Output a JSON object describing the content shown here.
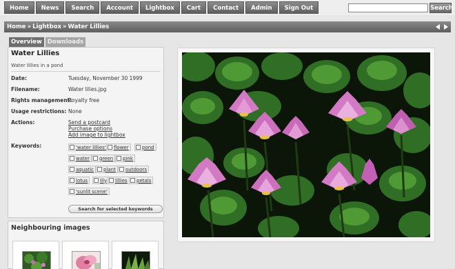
{
  "nav": {
    "items": [
      "Home",
      "News",
      "Search",
      "Account",
      "Lightbox",
      "Cart",
      "Contact",
      "Admin",
      "Sign Out"
    ],
    "search_value": "",
    "search_button": "Search"
  },
  "breadcrumb": {
    "home": "Home",
    "sep": "»",
    "lightbox": "Lightbox",
    "current": "Water Lillies"
  },
  "tabs": [
    "Overview",
    "Downloads"
  ],
  "details": {
    "title": "Water Lillies",
    "description": "Water lillies in a pond",
    "date_label": "Date:",
    "date_value": "Tuesday, November 30 1999",
    "filename_label": "Filename:",
    "filename_value": "Water lilies.jpg",
    "rights_label": "Rights management:",
    "rights_value": "Royalty free",
    "usage_label": "Usage restrictions:",
    "usage_value": "None",
    "actions_label": "Actions:",
    "actions": [
      "Send a postcard",
      "Purchase options",
      "Add image to lightbox"
    ],
    "keywords_label": "Keywords:",
    "keywords": [
      "'water lillies'",
      "flower",
      "pond",
      "water",
      "green",
      "pink",
      "aquatic",
      "plant",
      "outdoors",
      "lotus",
      "lily",
      "lillies",
      "petals",
      "'sunlit scene'"
    ],
    "keywords_button": "Search for selected keywords"
  },
  "neighbouring": {
    "title": "Neighbouring images"
  },
  "colors": {
    "nav_bg": "#6f6f6f",
    "panel_bg": "#f4f4f4",
    "leaf_green": "#3f7a2a",
    "flower_pink": "#d77bc7"
  }
}
